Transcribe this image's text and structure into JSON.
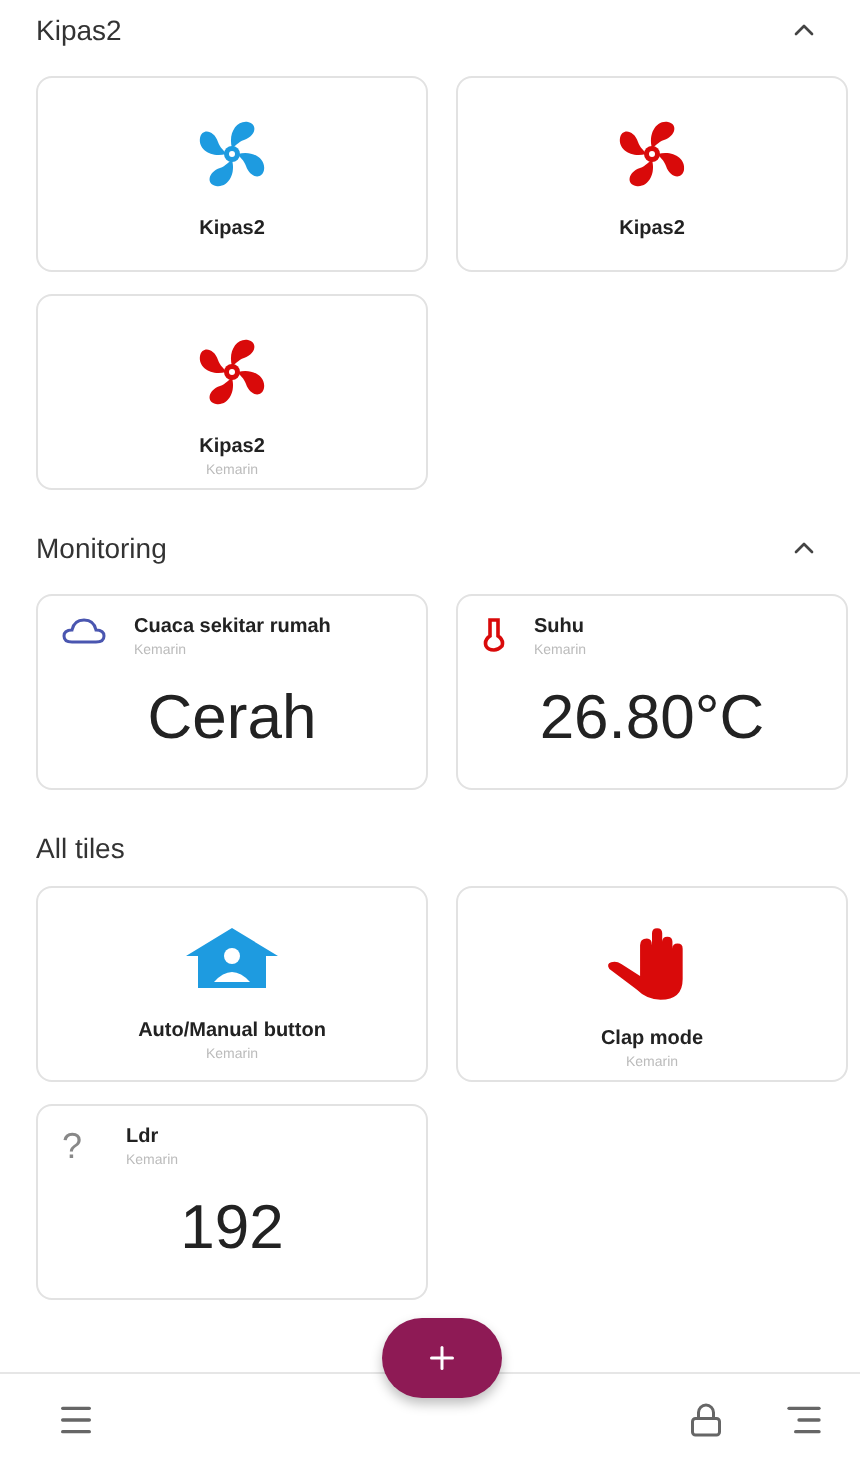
{
  "sections": [
    {
      "title": "Kipas2",
      "expanded": true,
      "tiles": [
        {
          "kind": "icon",
          "color": "#1e9be0",
          "label": "Kipas2"
        },
        {
          "kind": "icon",
          "color": "#d90a0a",
          "label": "Kipas2"
        },
        {
          "kind": "icon",
          "color": "#d90a0a",
          "label": "Kipas2",
          "subtitle": "Kemarin"
        }
      ]
    },
    {
      "title": "Monitoring",
      "expanded": true,
      "tiles": [
        {
          "kind": "value",
          "label": "Cuaca sekitar rumah",
          "subtitle": "Kemarin",
          "value": "Cerah"
        },
        {
          "kind": "value",
          "label": "Suhu",
          "subtitle": "Kemarin",
          "value": "26.80°C"
        }
      ]
    },
    {
      "title": "All tiles",
      "tiles": [
        {
          "kind": "icon",
          "color": "#1e9be0",
          "label": "Auto/Manual button",
          "subtitle": "Kemarin"
        },
        {
          "kind": "icon",
          "color": "#d90a0a",
          "label": "Clap mode",
          "subtitle": "Kemarin"
        },
        {
          "kind": "value",
          "glyph": "?",
          "label": "Ldr",
          "subtitle": "Kemarin",
          "value": "192"
        }
      ]
    }
  ]
}
